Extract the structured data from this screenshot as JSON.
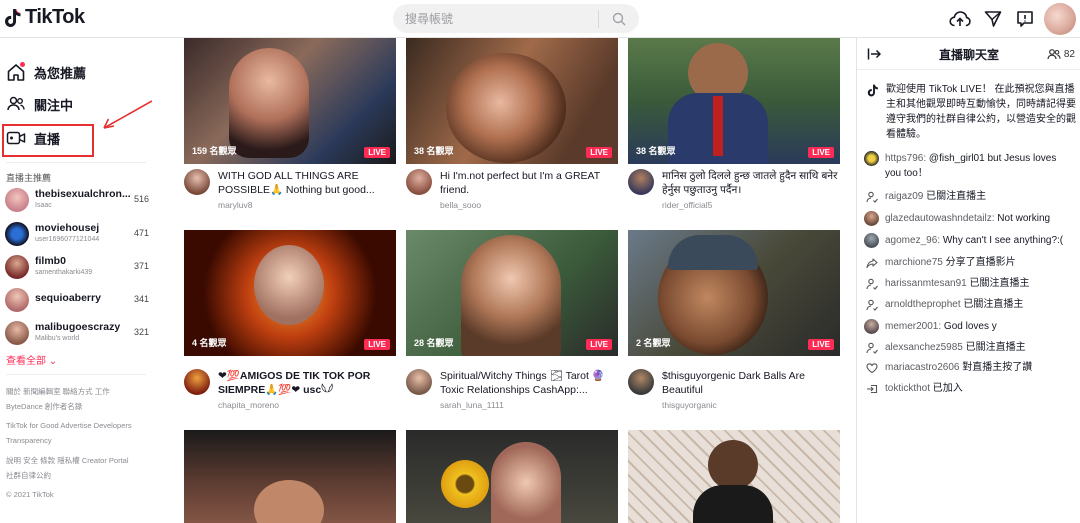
{
  "header": {
    "logo": "TikTok",
    "search_placeholder": "搜尋帳號"
  },
  "sidebar": {
    "nav": [
      {
        "label": "為您推薦",
        "icon": "home-icon"
      },
      {
        "label": "關注中",
        "icon": "following-icon"
      },
      {
        "label": "直播",
        "icon": "live-icon"
      }
    ],
    "section_title": "直播主推薦",
    "creators": [
      {
        "name": "thebisexualchron...",
        "sub": "Isaac",
        "count": "516"
      },
      {
        "name": "moviehousej",
        "sub": "user1696077121044",
        "count": "471"
      },
      {
        "name": "filmb0",
        "sub": "samenthakarki439",
        "count": "371"
      },
      {
        "name": "sequioaberry",
        "sub": "",
        "count": "341"
      },
      {
        "name": "malibugoescrazy",
        "sub": "Malibu's world",
        "count": "321"
      }
    ],
    "see_all": "查看全部",
    "footer": [
      "關於  新聞編輯室  聯絡方式  工作",
      "ByteDance  創作者名錄",
      "TikTok for Good  Advertise  Developers",
      "Transparency",
      "說明  安全  條款  隱私權  Creator Portal",
      "社群自律公約",
      "© 2021 TikTok"
    ]
  },
  "cards": [
    {
      "viewers": "159 名觀眾",
      "live": "LIVE",
      "title": "WITH GOD ALL THINGS ARE POSSIBLE🙏 Nothing but good...",
      "user": "maryluv8"
    },
    {
      "viewers": "38 名觀眾",
      "live": "LIVE",
      "title": "Hi I'm.not perfect but I'm a GREAT friend.",
      "user": "bella_sooo"
    },
    {
      "viewers": "38 名觀眾",
      "live": "LIVE",
      "title": "मानिस ठुलो दिलले हुन्छ जातले हुदैन साथि बनेर हेर्नुस पछुताउनु पर्दैन।",
      "user": "rider_official5"
    },
    {
      "viewers": "4 名觀眾",
      "live": "LIVE",
      "title": "❤💯AMIGOS DE TIK TOK POR SIEMPRE🙏💯❤ usc𓆩𓆪",
      "user": "chapita_moreno"
    },
    {
      "viewers": "28 名觀眾",
      "live": "LIVE",
      "title": "Spiritual/Witchy Things 🌫 Tarot 🔮 Toxic Relationships CashApp:...",
      "user": "sarah_luna_1111"
    },
    {
      "viewers": "2 名觀眾",
      "live": "LIVE",
      "title": "$thisguyorgenic Dark Balls Are Beautiful",
      "user": "thisguyorganic"
    },
    {
      "viewers": "",
      "live": "",
      "title": "",
      "user": ""
    },
    {
      "viewers": "",
      "live": "",
      "title": "",
      "user": ""
    },
    {
      "viewers": "",
      "live": "",
      "title": "",
      "user": ""
    }
  ],
  "chat": {
    "title": "直播聊天室",
    "viewer_count": "82",
    "welcome": "歡迎使用 TikTok LIVE！ 在此預祝您與直播主和其他觀眾即時互動愉快，同時請記得要遵守我們的社群自律公約，以營造安全的觀看體驗。",
    "messages": [
      {
        "user": "https796:",
        "text": " @fish_girl01 but Jesus loves you too！",
        "icon": "avatar"
      },
      {
        "user": "raigaz09",
        "text": " 已關注直播主",
        "icon": "follow-icon"
      },
      {
        "user": "glazedautowashndetailz:",
        "text": " Not working",
        "icon": "avatar"
      },
      {
        "user": "agomez_96:",
        "text": " Why can't I see anything?:(",
        "icon": "avatar"
      },
      {
        "user": "marchione75",
        "text": " 分享了直播影片",
        "icon": "share-icon"
      },
      {
        "user": "harissanmtesan91",
        "text": " 已關注直播主",
        "icon": "follow-icon"
      },
      {
        "user": "arnoldtheprophet",
        "text": " 已關注直播主",
        "icon": "follow-icon"
      },
      {
        "user": "memer2001:",
        "text": " God loves y",
        "icon": "avatar"
      },
      {
        "user": "alexsanchez5985",
        "text": " 已關注直播主",
        "icon": "follow-icon"
      },
      {
        "user": "mariacastro2606",
        "text": " 對直播主按了讚",
        "icon": "heart-icon"
      },
      {
        "user": "toktickthot",
        "text": " 已加入",
        "icon": "join-icon"
      }
    ]
  }
}
